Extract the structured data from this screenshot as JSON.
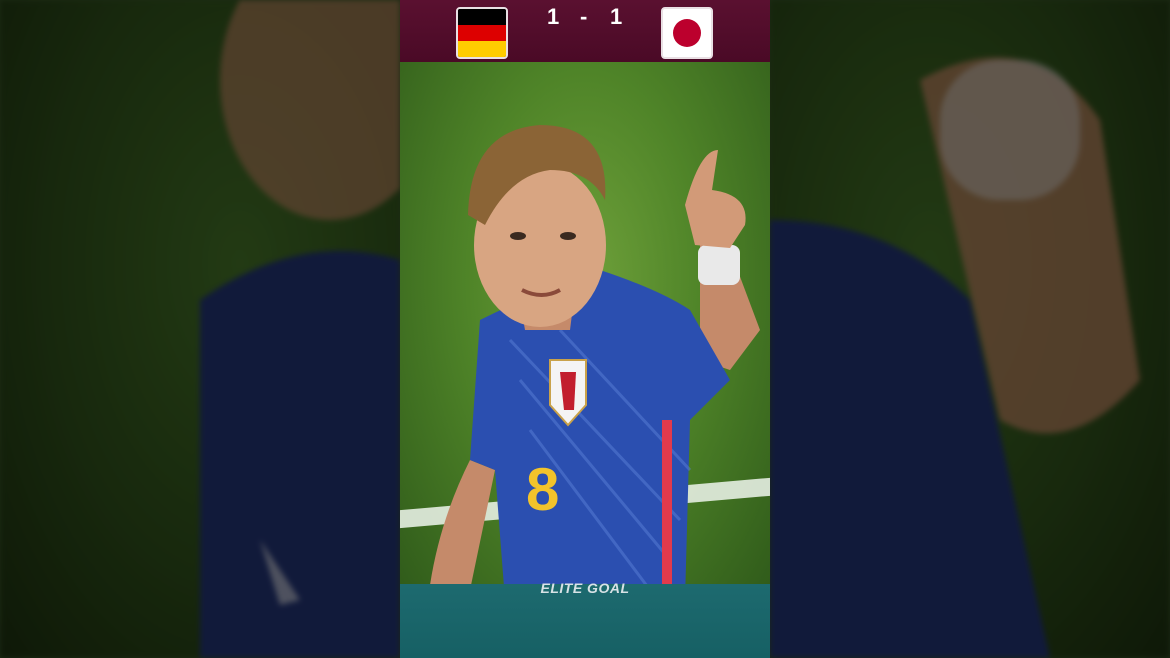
{
  "scoreboard": {
    "home_team_flag": "germany-flag-icon",
    "away_team_flag": "japan-flag-icon",
    "home_score": "1",
    "separator": "-",
    "away_score": "1",
    "colors": {
      "bar": "#4a0a26",
      "germany": [
        "#000000",
        "#dd0000",
        "#ffcc00"
      ],
      "japan_disc": "#bc002d"
    }
  },
  "player": {
    "shirt_number": "8",
    "kit_color": "#2b4fb0",
    "number_color": "#f2c32b"
  },
  "watermark": {
    "text": "ELITE GOAL"
  }
}
